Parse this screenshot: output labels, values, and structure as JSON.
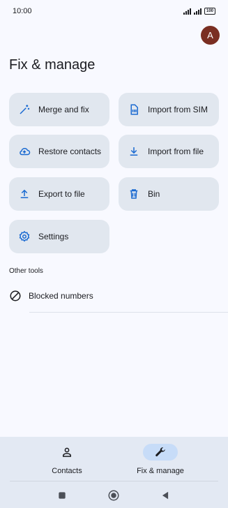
{
  "status_bar": {
    "time": "10:00",
    "battery": "100"
  },
  "header": {
    "avatar_letter": "A",
    "title": "Fix & manage"
  },
  "cards": {
    "merge": "Merge and fix",
    "import_sim": "Import from SIM",
    "restore": "Restore contacts",
    "import_file": "Import from file",
    "export": "Export to file",
    "bin": "Bin",
    "settings": "Settings"
  },
  "other_tools": {
    "label": "Other tools",
    "blocked": "Blocked numbers"
  },
  "bottom_nav": {
    "contacts": "Contacts",
    "fix_manage": "Fix & manage"
  },
  "icons": {
    "merge": "magic-wand-icon",
    "import_sim": "sim-card-icon",
    "restore": "cloud-upload-icon",
    "import_file": "download-icon",
    "export": "upload-icon",
    "bin": "trash-icon",
    "settings": "gear-icon",
    "blocked": "block-icon",
    "contacts": "person-icon",
    "fix_manage": "wrench-icon"
  },
  "colors": {
    "accent": "#1a6ad1",
    "card": "#e1e7ef",
    "avatar": "#7a2e22",
    "nav_active": "#c7dcf8"
  }
}
